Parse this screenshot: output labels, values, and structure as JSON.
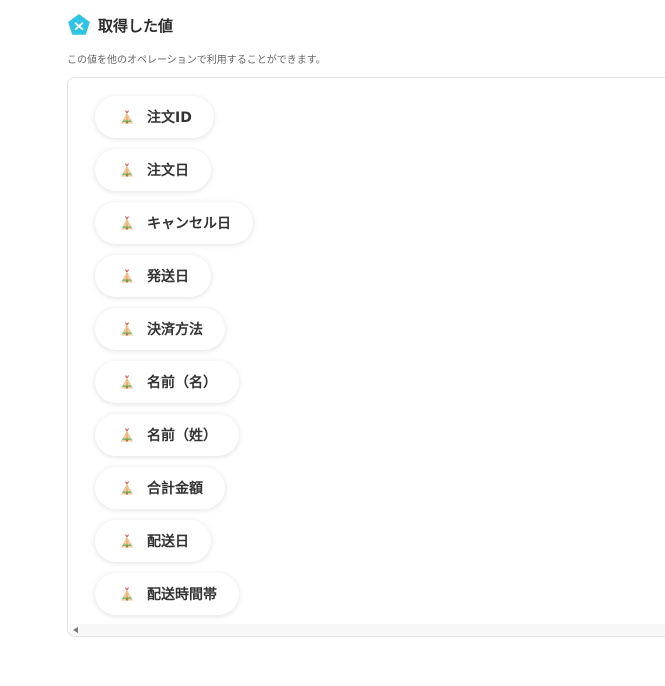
{
  "header": {
    "icon": "pentagon-badge-icon",
    "title": "取得した値",
    "description": "この値を他のオペレーションで利用することができます。"
  },
  "chip_icon": "tipi-tent-icon",
  "items": [
    {
      "label": "注文ID"
    },
    {
      "label": "注文日"
    },
    {
      "label": "キャンセル日"
    },
    {
      "label": "発送日"
    },
    {
      "label": "決済方法"
    },
    {
      "label": "名前（名）"
    },
    {
      "label": "名前（姓）"
    },
    {
      "label": "合計金額"
    },
    {
      "label": "配送日"
    },
    {
      "label": "配送時間帯"
    }
  ],
  "colors": {
    "accent": "#2ec4e6",
    "text": "#333333",
    "border": "#e3e3e3"
  }
}
